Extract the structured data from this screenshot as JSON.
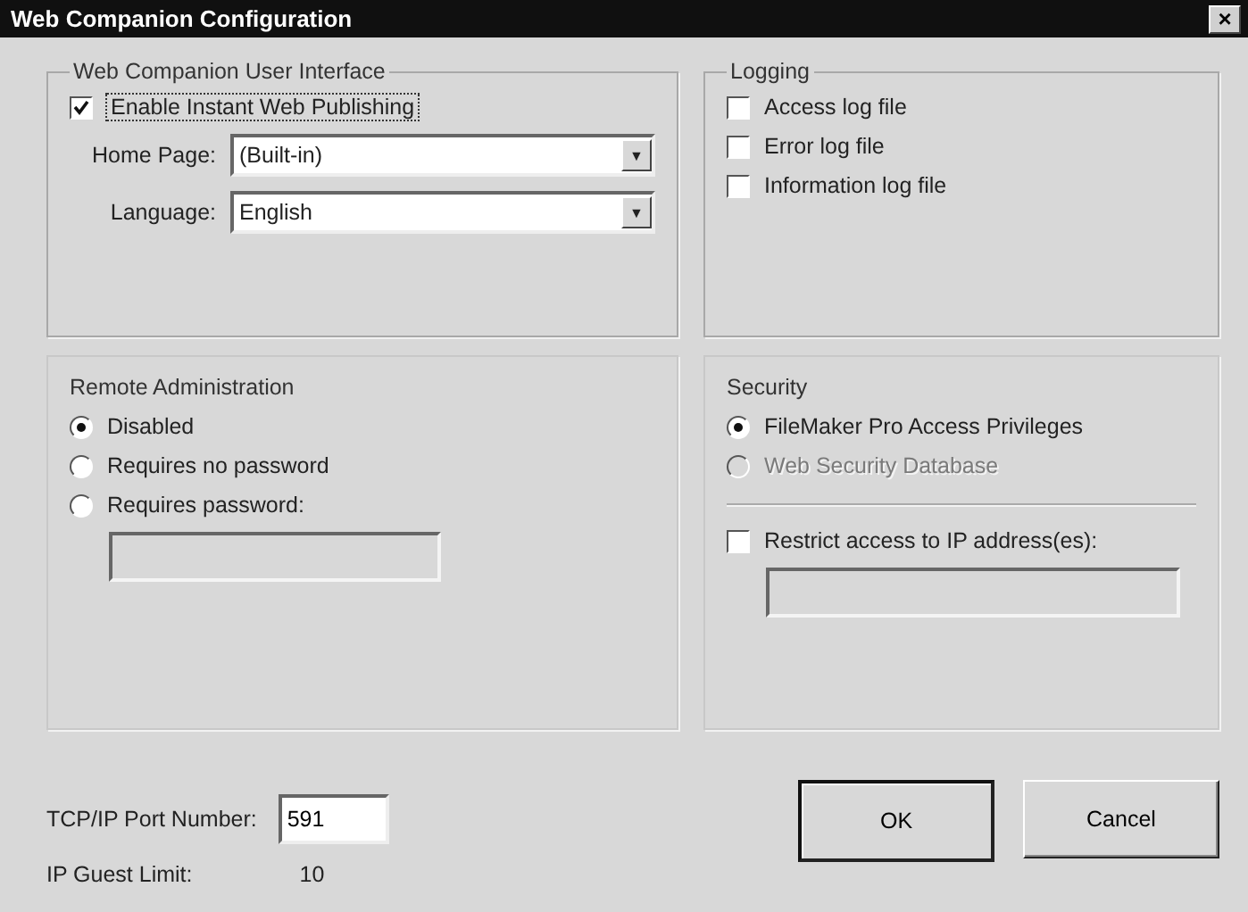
{
  "window": {
    "title": "Web Companion Configuration",
    "close": "×"
  },
  "user_interface": {
    "title": "Web Companion User Interface",
    "enable": {
      "label": "Enable Instant Web Publishing",
      "checked": true
    },
    "fields": [
      {
        "label": "Home Page:",
        "value": "(Built-in)",
        "arrow": "▼"
      },
      {
        "label": "Language:",
        "value": "English",
        "arrow": "▼"
      }
    ]
  },
  "logging": {
    "title": "Logging",
    "items": [
      {
        "label": "Access log file",
        "checked": false
      },
      {
        "label": "Error log file",
        "checked": false
      },
      {
        "label": "Information log file",
        "checked": false
      }
    ]
  },
  "remote_administration": {
    "title": "Remote Administration",
    "options": [
      {
        "label": "Disabled",
        "selected": true
      },
      {
        "label": "Requires no password",
        "selected": false
      },
      {
        "label": "Requires password:",
        "selected": false
      }
    ]
  },
  "security": {
    "title": "Security",
    "options": [
      {
        "label": "FileMaker Pro Access Privileges",
        "selected": true,
        "disabled": false
      },
      {
        "label": "Web Security Database",
        "selected": false,
        "disabled": true
      }
    ],
    "restrict": {
      "label": "Restrict access to IP address(es):",
      "checked": false
    }
  },
  "port": {
    "label": "TCP/IP Port Number:",
    "value": "591"
  },
  "guest_limit": {
    "label": "IP Guest Limit:",
    "value": "10"
  },
  "buttons": [
    "OK",
    "Cancel"
  ]
}
